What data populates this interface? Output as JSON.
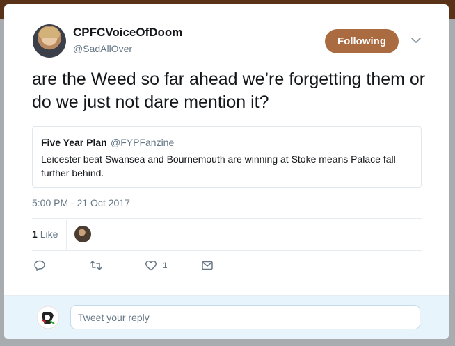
{
  "tweet": {
    "display_name": "CPFCVoiceOfDoom",
    "handle": "@SadAllOver",
    "follow_label": "Following",
    "text": "are the Weed so far ahead we’re forgetting them or do we just not dare mention it?",
    "quoted": {
      "name": "Five Year Plan",
      "handle": "@FYPFanzine",
      "text": "Leicester beat Swansea and Bournemouth are winning at Stoke means Palace fall further behind."
    },
    "timestamp": "5:00 PM - 21 Oct 2017",
    "stats": {
      "likes_count": "1",
      "likes_label": "Like"
    },
    "actions": {
      "reply_icon": "reply-icon",
      "retweet_icon": "retweet-icon",
      "like_icon": "heart-icon",
      "like_count": "1",
      "dm_icon": "envelope-icon"
    }
  },
  "reply": {
    "placeholder": "Tweet your reply"
  },
  "colors": {
    "follow_button": "#a96b3f",
    "topbar": "#5a3217",
    "reply_area": "#e8f4fb"
  }
}
